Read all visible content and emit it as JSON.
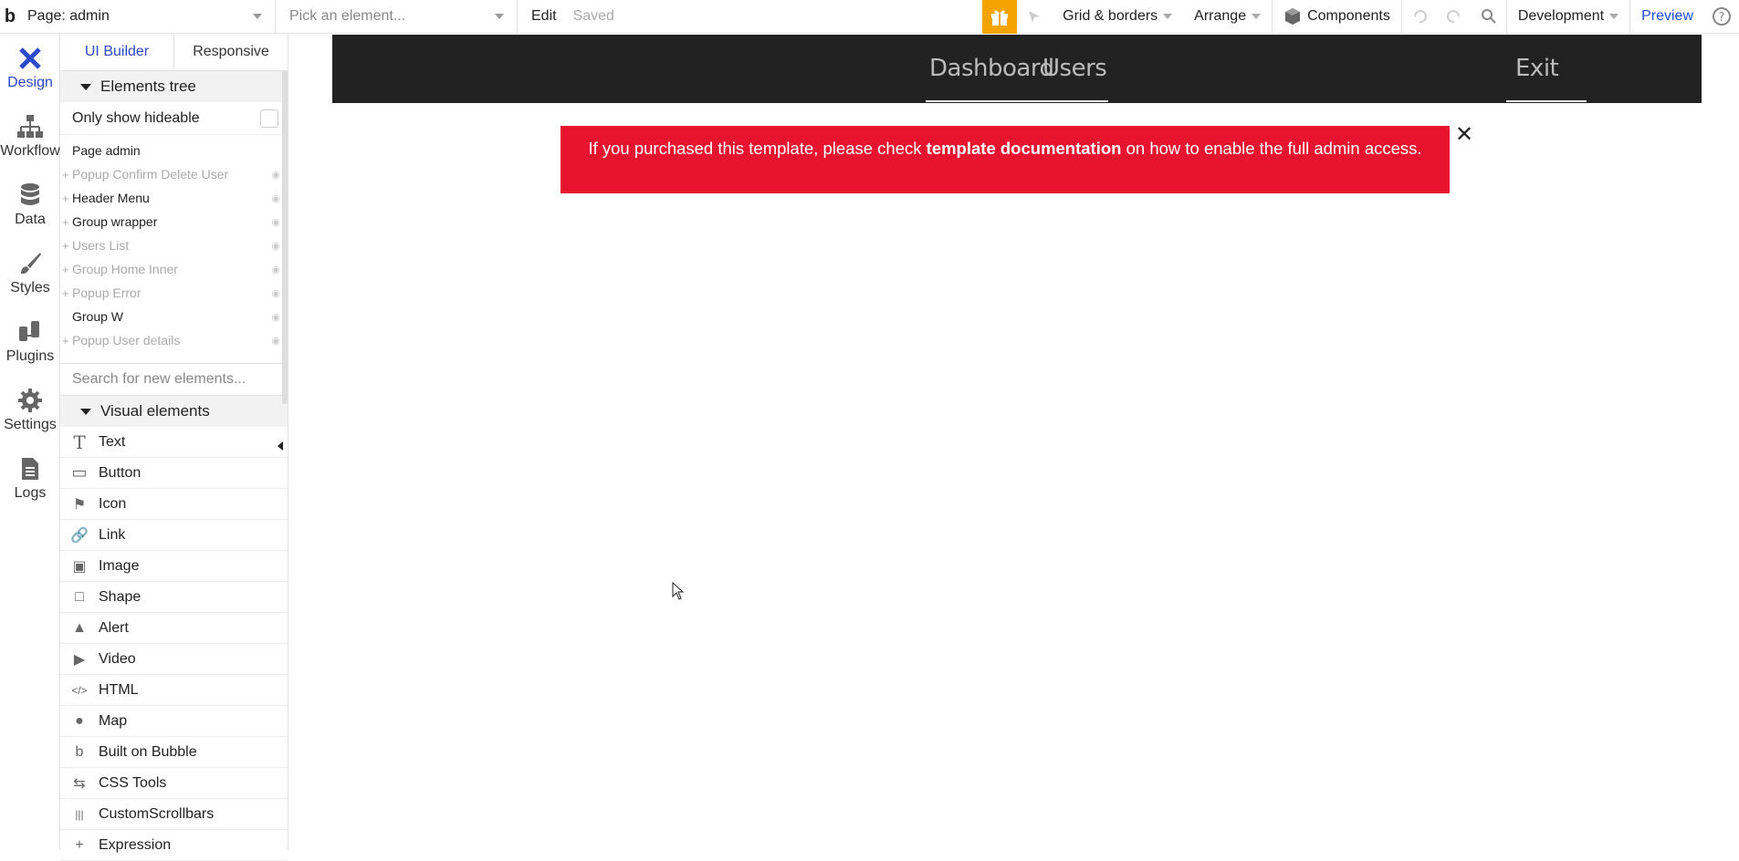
{
  "topbar": {
    "logo": "b",
    "page_select": "Page: admin",
    "element_select_placeholder": "Pick an element...",
    "edit": "Edit",
    "saved": "Saved",
    "grid": "Grid & borders",
    "arrange": "Arrange",
    "components": "Components",
    "development": "Development",
    "preview": "Preview",
    "accent": "#f4a300"
  },
  "rail": [
    {
      "label": "Design",
      "icon": "design-icon"
    },
    {
      "label": "Workflow",
      "icon": "workflow-icon"
    },
    {
      "label": "Data",
      "icon": "database-icon"
    },
    {
      "label": "Styles",
      "icon": "brush-icon"
    },
    {
      "label": "Plugins",
      "icon": "plugin-icon"
    },
    {
      "label": "Settings",
      "icon": "gear-icon"
    },
    {
      "label": "Logs",
      "icon": "document-icon"
    }
  ],
  "panel": {
    "tab_builder": "UI Builder",
    "tab_responsive": "Responsive",
    "elements_tree": "Elements tree",
    "only_show_hideable": "Only show hideable",
    "tree": [
      {
        "label": "Page admin",
        "dim": false,
        "plus": false
      },
      {
        "label": "Popup Confirm Delete User",
        "dim": true,
        "plus": true
      },
      {
        "label": "Header Menu",
        "dim": false,
        "plus": true
      },
      {
        "label": "Group wrapper",
        "dim": false,
        "plus": true
      },
      {
        "label": "Users List",
        "dim": true,
        "plus": true
      },
      {
        "label": "Group Home Inner",
        "dim": true,
        "plus": true
      },
      {
        "label": "Popup Error",
        "dim": true,
        "plus": true
      },
      {
        "label": "Group W",
        "dim": false,
        "plus": false
      },
      {
        "label": "Popup User details",
        "dim": true,
        "plus": true
      }
    ],
    "search_placeholder": "Search for new elements...",
    "visual_elements": "Visual elements",
    "visual_items": [
      "Text",
      "Button",
      "Icon",
      "Link",
      "Image",
      "Shape",
      "Alert",
      "Video",
      "HTML",
      "Map",
      "Built on Bubble",
      "CSS Tools",
      "CustomScrollbars",
      "Expression"
    ]
  },
  "canvas": {
    "nav_dashboard": "Dashboard",
    "nav_users": "Users",
    "nav_exit": "Exit",
    "alert_pre": "If you purchased this template, please check ",
    "alert_bold": "template documentation",
    "alert_post": " on how to enable the full admin access.",
    "alert_color": "#e8142f",
    "header_color": "#222222"
  }
}
